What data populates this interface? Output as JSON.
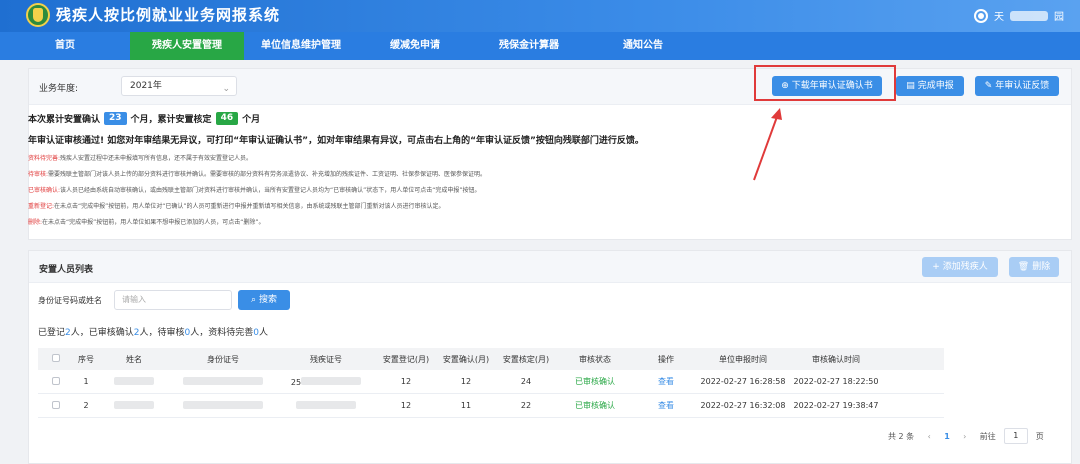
{
  "app": {
    "title": "残疾人按比例就业业务网报系统",
    "user_visible": "天",
    "user_tail": "园"
  },
  "nav": [
    "首页",
    "残疾人安置管理",
    "单位信息维护管理",
    "缓减免申请",
    "残保金计算器",
    "通知公告"
  ],
  "filters": {
    "year_label": "业务年度:",
    "year_value": "2021年"
  },
  "actions": {
    "download": "下载年审认证确认书",
    "complete": "完成申报",
    "feedback": "年审认证反馈"
  },
  "summary": {
    "prefix": "本次累计安置确认",
    "confirmed": "23",
    "mid": "个月，累计安置核定",
    "approved": "46",
    "suffix": "个月",
    "passed": "年审认证审核通过! 如您对年审结果无异议，可打印“年审认证确认书”，如对年审结果有异议，可点击右上角的“年审认证反馈”按钮向残联部门进行反馈。"
  },
  "notes": [
    {
      "k": "资料待完善:",
      "v": "残疾人安置过程中还未申报填写所有信息，还不属于有效安置登记人员。"
    },
    {
      "k": "待审核:",
      "v": "需要残联主管部门对该人员上传的部分资料进行审核并确认。需要审核的部分资料有劳务派遣协议、补充增加的残疾证件、工资证明、社保参保证明、医保参保证明。"
    },
    {
      "k": "已审核确认:",
      "v": "该人员已经由系统自动审核确认，或由残联主管部门对资料进行审核并确认，当所有安置登记人员均为“已审核确认”状态下，用人单位可点击“完成申报”按钮。"
    },
    {
      "k": "重新登记:",
      "v": "在未点击“完成申报”按钮前，用人单位对“已确认”的人员可重新进行申报并重新填写相关信息，由系统或残联主管部门重新对该人员进行审核认定。"
    },
    {
      "k": "删除:",
      "v": "在未点击“完成申报”按钮前，用人单位如果不想申报已添加的人员，可点击“删除”。"
    }
  ],
  "list": {
    "title": "安置人员列表",
    "add": "添加残疾人",
    "delete": "删除",
    "id_label": "身份证号码或姓名",
    "id_placeholder": "请输入",
    "search": "搜索",
    "stats": {
      "t1": "已登记",
      "n1": "2",
      "t2": "人，已审核确认",
      "n2": "2",
      "t3": "人，待审核",
      "n3": "0",
      "t4": "人，资料待完善",
      "n4": "0",
      "t5": "人"
    },
    "columns": [
      "序号",
      "姓名",
      "身份证号",
      "残疾证号",
      "安置登记(月)",
      "安置确认(月)",
      "安置核定(月)",
      "审核状态",
      "操作",
      "单位申报时间",
      "审核确认时间"
    ],
    "rows": [
      {
        "idx": "1",
        "disab_frag": "25",
        "reg": "12",
        "conf": "12",
        "appr": "24",
        "status": "已审核确认",
        "op": "查看",
        "apply": "2022-02-27 16:28:58",
        "audit": "2022-02-27 18:22:50"
      },
      {
        "idx": "2",
        "disab_frag": "",
        "reg": "12",
        "conf": "11",
        "appr": "22",
        "status": "已审核确认",
        "op": "查看",
        "apply": "2022-02-27 16:32:08",
        "audit": "2022-02-27 19:38:47"
      }
    ],
    "pager": {
      "total": "共 2 条",
      "page": "1",
      "goto": "前往",
      "unit": "页",
      "goto_value": "1"
    }
  },
  "colors": {
    "primary": "#3a8ee6",
    "nav": "#2a7de1",
    "active": "#28a745",
    "danger": "#e03a3a"
  }
}
